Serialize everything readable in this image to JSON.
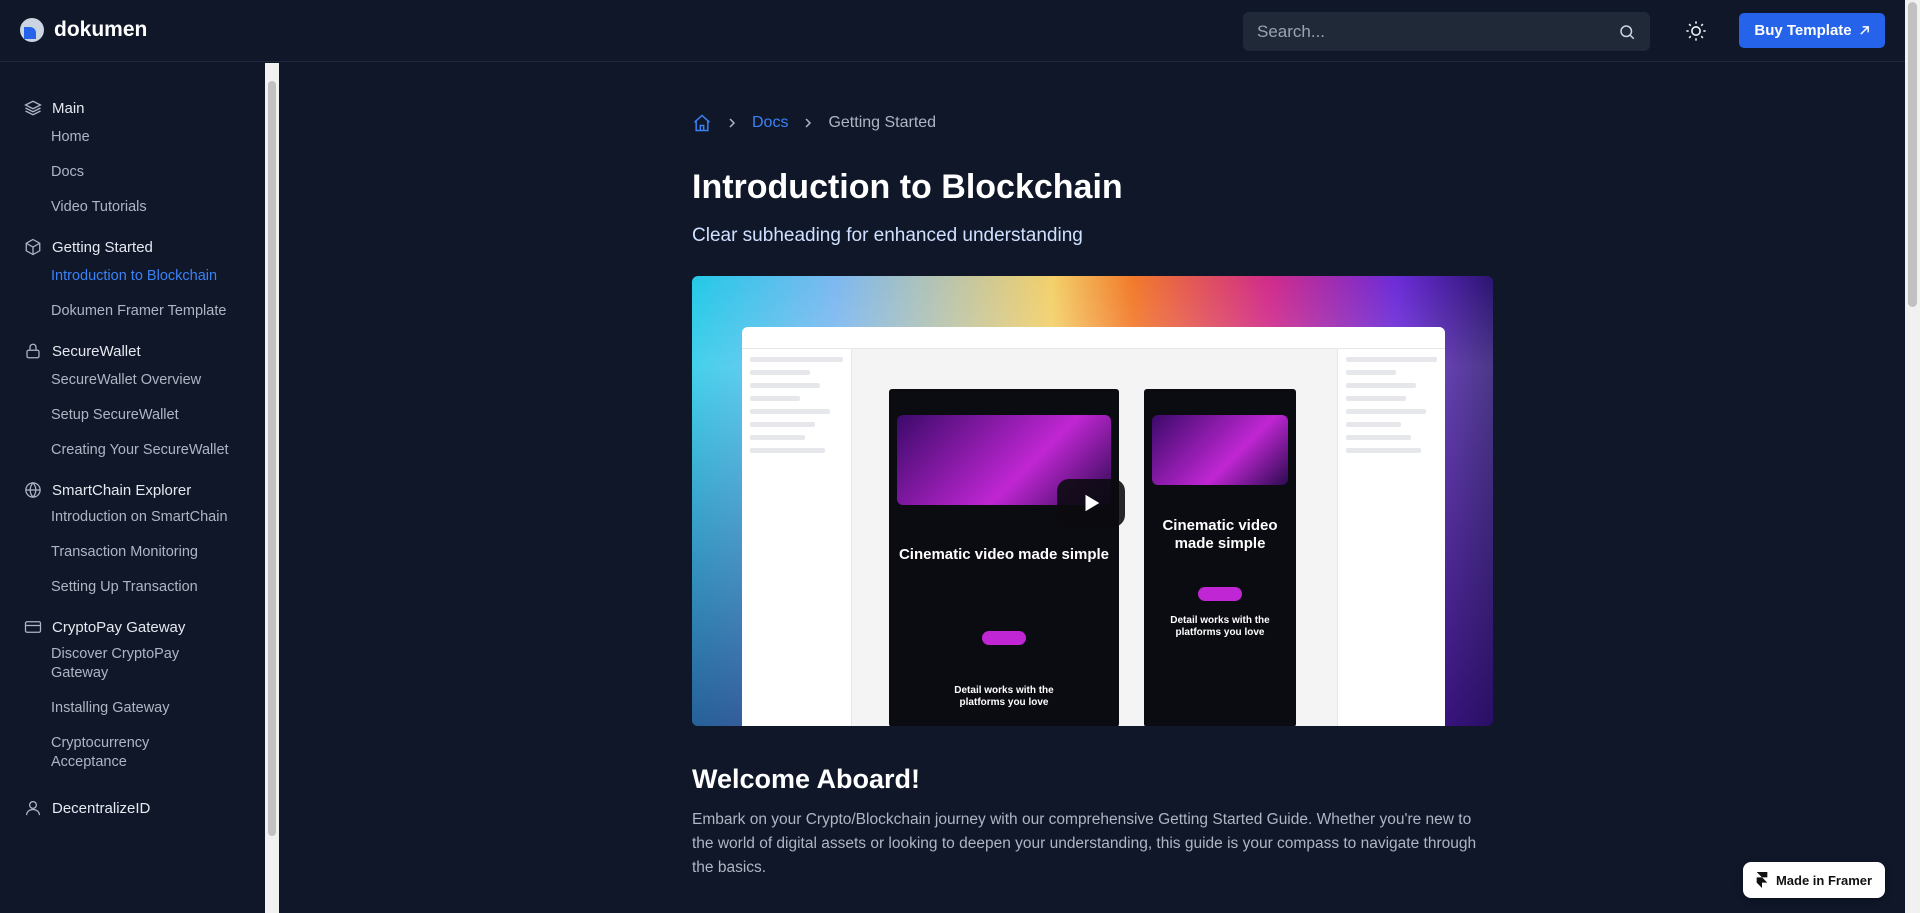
{
  "header": {
    "logo_text": "dokumen",
    "search_placeholder": "Search...",
    "buy_label": "Buy Template",
    "accent": "#2563eb"
  },
  "sidebar": {
    "groups": [
      {
        "icon": "layers-icon",
        "title": "Main",
        "items": [
          "Home",
          "Docs",
          "Video Tutorials"
        ]
      },
      {
        "icon": "box-icon",
        "title": "Getting Started",
        "items": [
          "Introduction to Blockchain",
          "Dokumen Framer Template"
        ],
        "active": "Introduction to Blockchain"
      },
      {
        "icon": "lock-icon",
        "title": "SecureWallet",
        "items": [
          "SecureWallet Overview",
          "Setup SecureWallet",
          "Creating Your SecureWallet"
        ]
      },
      {
        "icon": "globe-icon",
        "title": "SmartChain Explorer",
        "items": [
          "Introduction on SmartChain",
          "Transaction Monitoring",
          "Setting Up Transaction"
        ]
      },
      {
        "icon": "credit-card-icon",
        "title": "CryptoPay Gateway",
        "items": [
          "Discover CryptoPay Gateway",
          "Installing Gateway",
          "Cryptocurrency Acceptance"
        ]
      },
      {
        "icon": "user-icon",
        "title": "DecentralizeID",
        "items": []
      }
    ]
  },
  "breadcrumb": {
    "docs": "Docs",
    "current": "Getting Started"
  },
  "main": {
    "title": "Introduction to Blockchain",
    "subtitle": "Clear subheading for enhanced understanding",
    "video": {
      "phone1_title": "Cinematic video made simple",
      "phone1_sub": "Detail works with the platforms you love",
      "phone2_title": "Cinematic video made simple",
      "phone2_sub": "Detail works with the platforms you love"
    },
    "section_title": "Welcome Aboard!",
    "section_body": "Embark on your Crypto/Blockchain journey with our comprehensive Getting Started Guide. Whether you're new to the world of digital assets or looking to deepen your understanding, this guide is your compass to navigate through the basics."
  },
  "badge": {
    "label": "Made in Framer"
  }
}
